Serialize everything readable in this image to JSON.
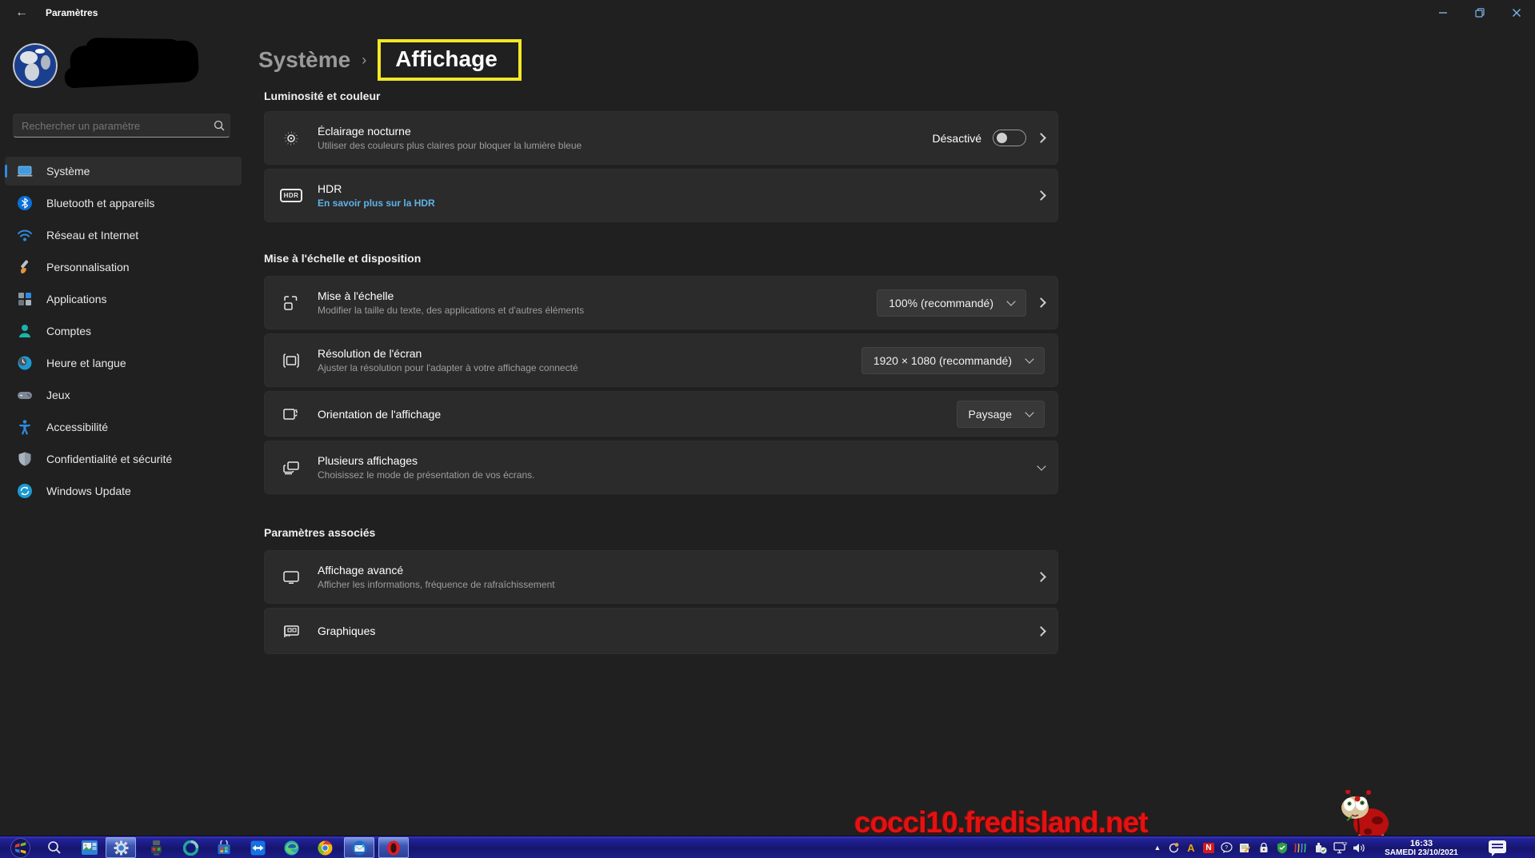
{
  "titlebar": {
    "title": "Paramètres"
  },
  "sidebar": {
    "search_placeholder": "Rechercher un paramètre",
    "items": [
      {
        "label": "Système",
        "icon": "system-icon",
        "selected": true
      },
      {
        "label": "Bluetooth et appareils",
        "icon": "bluetooth-icon"
      },
      {
        "label": "Réseau et Internet",
        "icon": "network-icon"
      },
      {
        "label": "Personnalisation",
        "icon": "personalization-icon"
      },
      {
        "label": "Applications",
        "icon": "apps-icon"
      },
      {
        "label": "Comptes",
        "icon": "accounts-icon"
      },
      {
        "label": "Heure et langue",
        "icon": "time-language-icon"
      },
      {
        "label": "Jeux",
        "icon": "gaming-icon"
      },
      {
        "label": "Accessibilité",
        "icon": "accessibility-icon"
      },
      {
        "label": "Confidentialité et sécurité",
        "icon": "privacy-icon"
      },
      {
        "label": "Windows Update",
        "icon": "windows-update-icon"
      }
    ]
  },
  "header": {
    "parent": "Système",
    "separator": "›",
    "current": "Affichage"
  },
  "sections": [
    {
      "title": "Luminosité et couleur",
      "rows": [
        {
          "title": "Éclairage nocturne",
          "subtitle": "Utiliser des couleurs plus claires pour bloquer la lumière bleue",
          "toggle_label": "Désactivé",
          "toggle_state": "off"
        },
        {
          "title": "HDR",
          "link": "En savoir plus sur la HDR",
          "badge": "HDR"
        }
      ]
    },
    {
      "title": "Mise à l'échelle et disposition",
      "rows": [
        {
          "title": "Mise à l'échelle",
          "subtitle": "Modifier la taille du texte, des applications et d'autres éléments",
          "dropdown": "100% (recommandé)"
        },
        {
          "title": "Résolution de l'écran",
          "subtitle": "Ajuster la résolution pour l'adapter à votre affichage connecté",
          "dropdown": "1920 × 1080 (recommandé)"
        },
        {
          "title": "Orientation de l'affichage",
          "dropdown": "Paysage"
        },
        {
          "title": "Plusieurs affichages",
          "subtitle": "Choisissez le mode de présentation de vos écrans."
        }
      ]
    },
    {
      "title": "Paramètres associés",
      "rows": [
        {
          "title": "Affichage avancé",
          "subtitle": "Afficher les informations, fréquence de rafraîchissement"
        },
        {
          "title": "Graphiques"
        }
      ]
    }
  ],
  "watermark": "cocci10.fredisland.net",
  "taskbar": {
    "apps": [
      "start-orb",
      "search",
      "photo-app",
      "settings",
      "media-robot",
      "ring-app",
      "microsoft-store",
      "teamviewer",
      "edge",
      "chrome",
      "thunderbird",
      "opera"
    ],
    "tray": [
      "show-hidden",
      "sync",
      "antivirus-a",
      "norton-n",
      "help-balloon",
      "notes",
      "hotspot-lock",
      "security-shield",
      "signal-waves",
      "usb-eject",
      "display-monitor",
      "volume"
    ],
    "clock": {
      "time": "16:33",
      "date": "SAMEDI 23/10/2021"
    }
  },
  "colors": {
    "accent": "#2f8ae0",
    "link_blue": "#5fb2e8",
    "annotation_yellow": "#f3e825",
    "watermark_red": "#e31212",
    "taskbar_navy": "#1d1d8c"
  }
}
